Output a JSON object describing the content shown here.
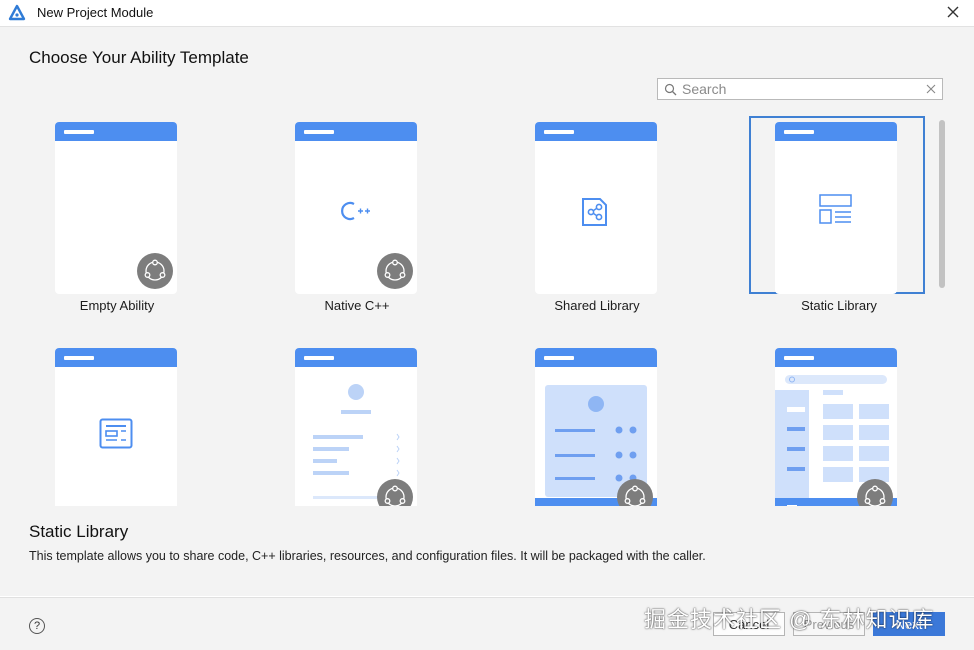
{
  "window": {
    "title": "New Project Module"
  },
  "heading": "Choose Your Ability Template",
  "search": {
    "placeholder": "Search",
    "value": ""
  },
  "templates": [
    {
      "label": "Empty Ability",
      "icon": "multi-device-badge-icon",
      "selected": false
    },
    {
      "label": "Native C++",
      "icon": "cpp-icon",
      "selected": false
    },
    {
      "label": "Shared Library",
      "icon": "shared-library-icon",
      "selected": false
    },
    {
      "label": "Static Library",
      "icon": "static-library-icon",
      "selected": true
    },
    {
      "label": "",
      "icon": "form-layout-icon",
      "selected": false
    },
    {
      "label": "",
      "icon": "profile-list-icon",
      "selected": false
    },
    {
      "label": "",
      "icon": "profile-card-icon",
      "selected": false
    },
    {
      "label": "",
      "icon": "category-grid-icon",
      "selected": false
    }
  ],
  "description": {
    "title": "Static Library",
    "text": "This template allows you to share code, C++ libraries, resources, and configuration files. It will be packaged with the caller."
  },
  "footer": {
    "help": "?",
    "cancel": "Cancel",
    "previous": "Previous",
    "next": "Next"
  },
  "watermark": "掘金技术社区 @ 东林知识库",
  "colors": {
    "accent": "#4d8ef0",
    "selected_border": "#3f80d3",
    "primary_button": "#3b78d8"
  }
}
